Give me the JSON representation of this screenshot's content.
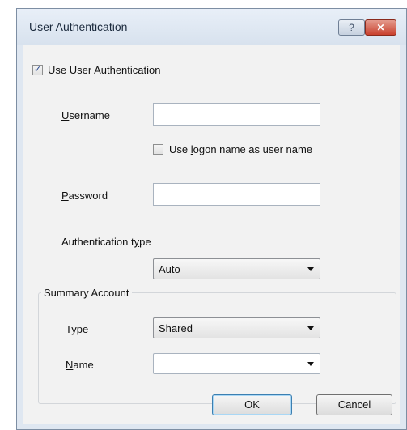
{
  "window": {
    "title": "User Authentication",
    "help_glyph": "?",
    "close_glyph": "✕"
  },
  "use_auth": {
    "checked": true,
    "label_pre": "Use User ",
    "label_accel": "A",
    "label_post": "uthentication"
  },
  "username": {
    "label_accel": "U",
    "label_rest": "sername",
    "value": ""
  },
  "use_logon": {
    "checked": false,
    "label_pre": "Use ",
    "label_accel": "l",
    "label_post": "ogon name as user name"
  },
  "password": {
    "label_accel": "P",
    "label_rest": "assword",
    "value": ""
  },
  "auth_type": {
    "label_pre": "Authentication t",
    "label_accel": "y",
    "label_post": "pe",
    "selected": "Auto"
  },
  "summary_account": {
    "group_label": "Summary Account",
    "type_label_accel": "T",
    "type_label_rest": "ype",
    "type_selected": "Shared",
    "name_label_accel": "N",
    "name_label_rest": "ame",
    "name_selected": ""
  },
  "buttons": {
    "ok": "OK",
    "cancel": "Cancel"
  },
  "check_glyph": "✓"
}
